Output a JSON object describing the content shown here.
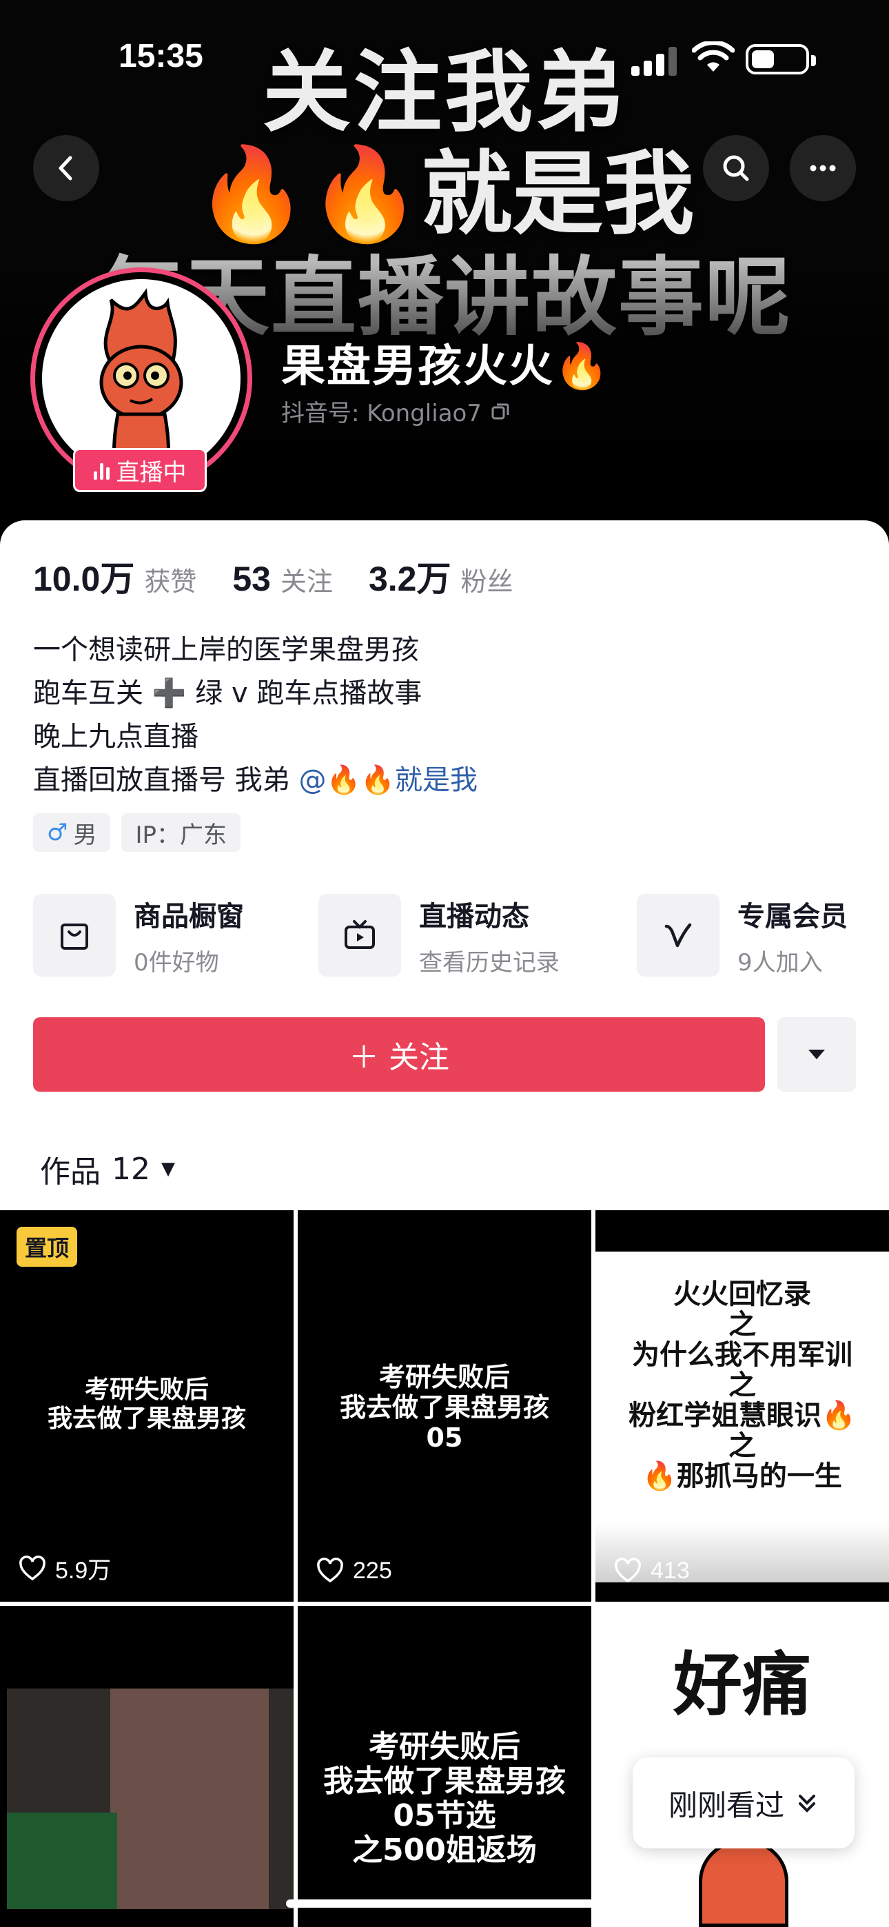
{
  "status_bar": {
    "time": "15:35"
  },
  "banner": {
    "line1": "关注我弟",
    "line2": "🔥🔥就是我",
    "line3": "每天直播讲故事呢"
  },
  "profile": {
    "nickname": "果盘男孩火火🔥",
    "douyin_id": "抖音号: Kongliao7",
    "live_badge": "直播中",
    "stats": [
      {
        "value": "10.0万",
        "label": "获赞"
      },
      {
        "value": "53",
        "label": "关注"
      },
      {
        "value": "3.2万",
        "label": "粉丝"
      }
    ],
    "bio": {
      "line1": "一个想读研上岸的医学果盘男孩",
      "line2": "跑车互关 ➕ 绿 v 跑车点播故事",
      "line3": "晚上九点直播",
      "line4_text": "直播回放直播号 我弟 ",
      "line4_mention": "@🔥🔥就是我"
    },
    "tags": {
      "gender": "男",
      "gender_symbol": "♂",
      "ip": "IP：广东"
    }
  },
  "features": [
    {
      "title": "商品橱窗",
      "sub": "0件好物",
      "icon": "shopping-bag-icon"
    },
    {
      "title": "直播动态",
      "sub": "查看历史记录",
      "icon": "tv-icon"
    },
    {
      "title": "专属会员",
      "sub": "9人加入",
      "icon": "v-icon"
    }
  ],
  "actions": {
    "follow_label": "＋ 关注"
  },
  "works": {
    "label": "作品",
    "count": "12"
  },
  "videos": [
    {
      "text": "考研失败后\n我去做了果盘男孩",
      "likes": "5.9万",
      "pinned": "置顶"
    },
    {
      "text": "考研失败后\n我去做了果盘男孩\n05",
      "likes": "225"
    },
    {
      "text": "火火回忆录\n之\n为什么我不用军训\n之\n粉红学姐慧眼识🔥\n之\n🔥那抓马的一生",
      "likes": "413"
    },
    {
      "text": "",
      "likes": ""
    },
    {
      "text": "考研失败后\n我去做了果盘男孩\n05节选\n之500姐返场",
      "likes": ""
    },
    {
      "text": "好痛",
      "likes": ""
    }
  ],
  "recent_label": "刚刚看过",
  "colors": {
    "accent": "#ea4359",
    "live": "#f23c69",
    "mention": "#2f5fa8",
    "pin": "#f8c93a"
  }
}
